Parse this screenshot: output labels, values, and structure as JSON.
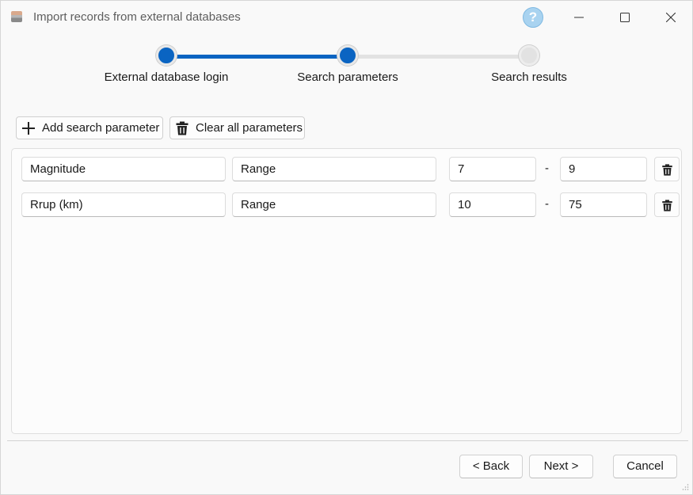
{
  "window": {
    "title": "Import records from external databases",
    "help_label": "?"
  },
  "stepper": {
    "steps": [
      {
        "label": "External database login",
        "state": "done"
      },
      {
        "label": "Search parameters",
        "state": "current"
      },
      {
        "label": "Search results",
        "state": "pending"
      }
    ],
    "accent_color": "#0a64c2"
  },
  "toolbar": {
    "add_label": "Add search parameter",
    "clear_label": "Clear all parameters",
    "add_icon": "plus-icon",
    "clear_icon": "trash-icon"
  },
  "parameters": [
    {
      "name": "Magnitude",
      "type": "Range",
      "min": "7",
      "max": "9",
      "separator": "-"
    },
    {
      "name": "Rrup (km)",
      "type": "Range",
      "min": "10",
      "max": "75",
      "separator": "-"
    }
  ],
  "footer": {
    "back_label": "< Back",
    "next_label": "Next >",
    "cancel_label": "Cancel"
  }
}
